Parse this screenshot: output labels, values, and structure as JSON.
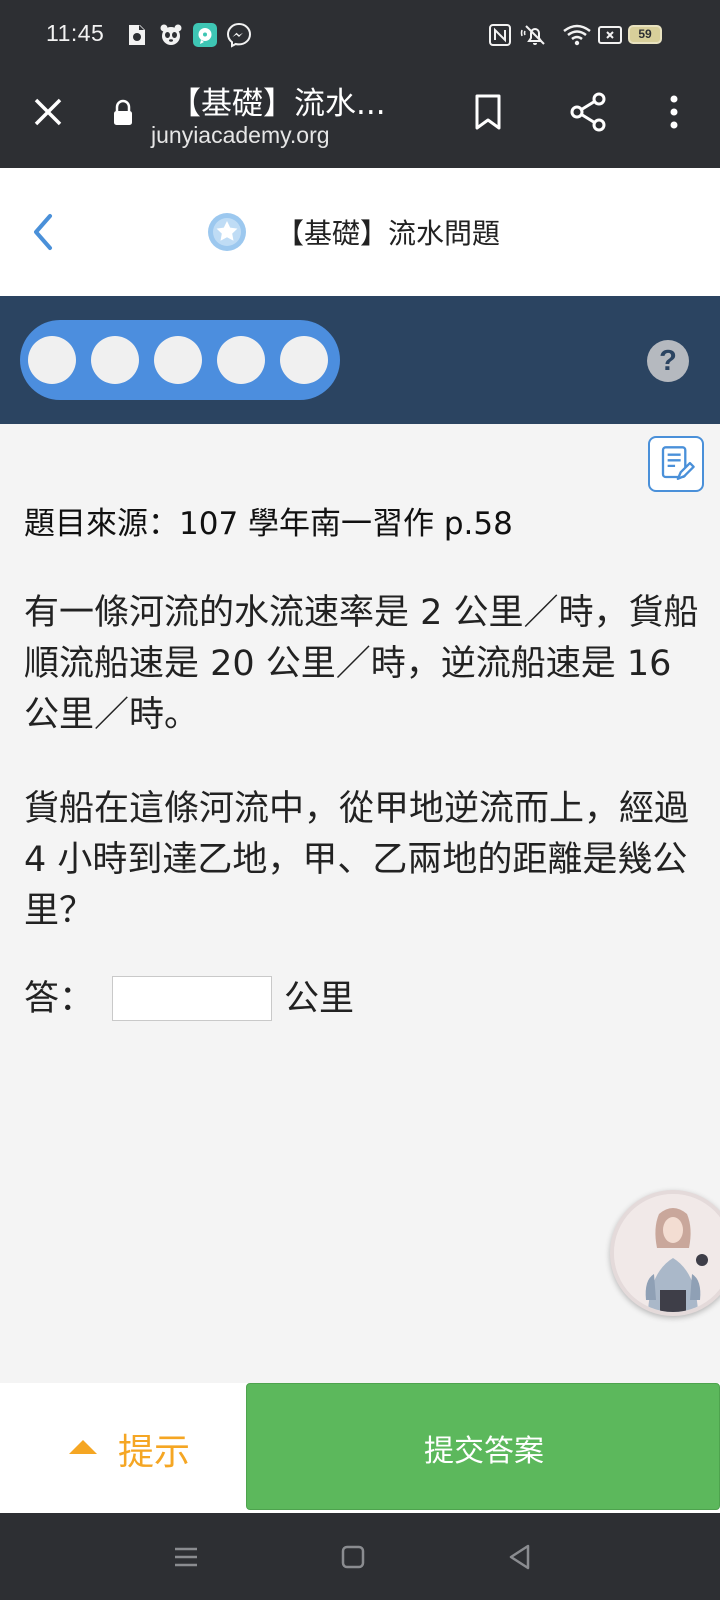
{
  "status_bar": {
    "time": "11:45",
    "battery": "59"
  },
  "browser": {
    "page_title": "【基礎】流水...",
    "url": "junyiacademy.org"
  },
  "header": {
    "title": "【基礎】流水問題"
  },
  "progress": {
    "dots": 5,
    "completed": 0,
    "help_label": "?"
  },
  "question": {
    "source": "題目來源：107 學年南一習作 p.58",
    "paragraph_1": "有一條河流的水流速率是 2 公里／時，貨船順流船速是 20 公里／時，逆流船速是 16 公里／時。",
    "paragraph_2": "貨船在這條河流中，從甲地逆流而上，經過 4 小時到達乙地，甲、乙兩地的距離是幾公里？",
    "answer_label": "答：",
    "answer_value": "",
    "answer_unit": "公里"
  },
  "actions": {
    "hint_label": "提示",
    "submit_label": "提交答案"
  },
  "colors": {
    "accent_blue": "#4c8ede",
    "progress_bg": "#2b4461",
    "submit_green": "#5cb85c",
    "hint_orange": "#f5a623",
    "chrome_dark": "#2d2f33"
  },
  "icons": {
    "back": "chevron-left-icon",
    "star": "star-badge-icon",
    "notes": "scratchpad-icon",
    "close": "close-icon",
    "lock": "lock-icon",
    "bookmark": "bookmark-icon",
    "share": "share-icon",
    "menu": "more-vert-icon"
  }
}
